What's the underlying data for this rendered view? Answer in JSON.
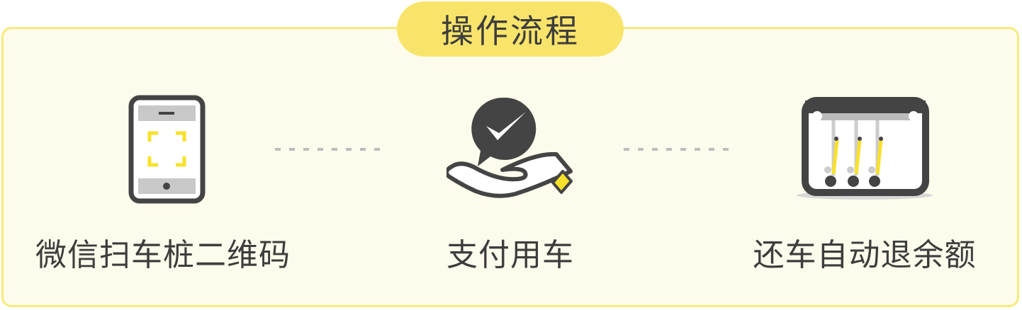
{
  "header": {
    "title": "操作流程"
  },
  "steps": [
    {
      "label": "微信扫车桩二维码",
      "icon": "phone-scan-icon"
    },
    {
      "label": "支付用车",
      "icon": "wechat-pay-hand-icon"
    },
    {
      "label": "还车自动退余额",
      "icon": "bike-dock-icon"
    }
  ],
  "colors": {
    "accent_yellow": "#f8e46b",
    "panel_background": "#fdfbeb",
    "panel_border": "#f7ea7d",
    "icon_dark": "#444444",
    "text": "#3d3d3d"
  }
}
